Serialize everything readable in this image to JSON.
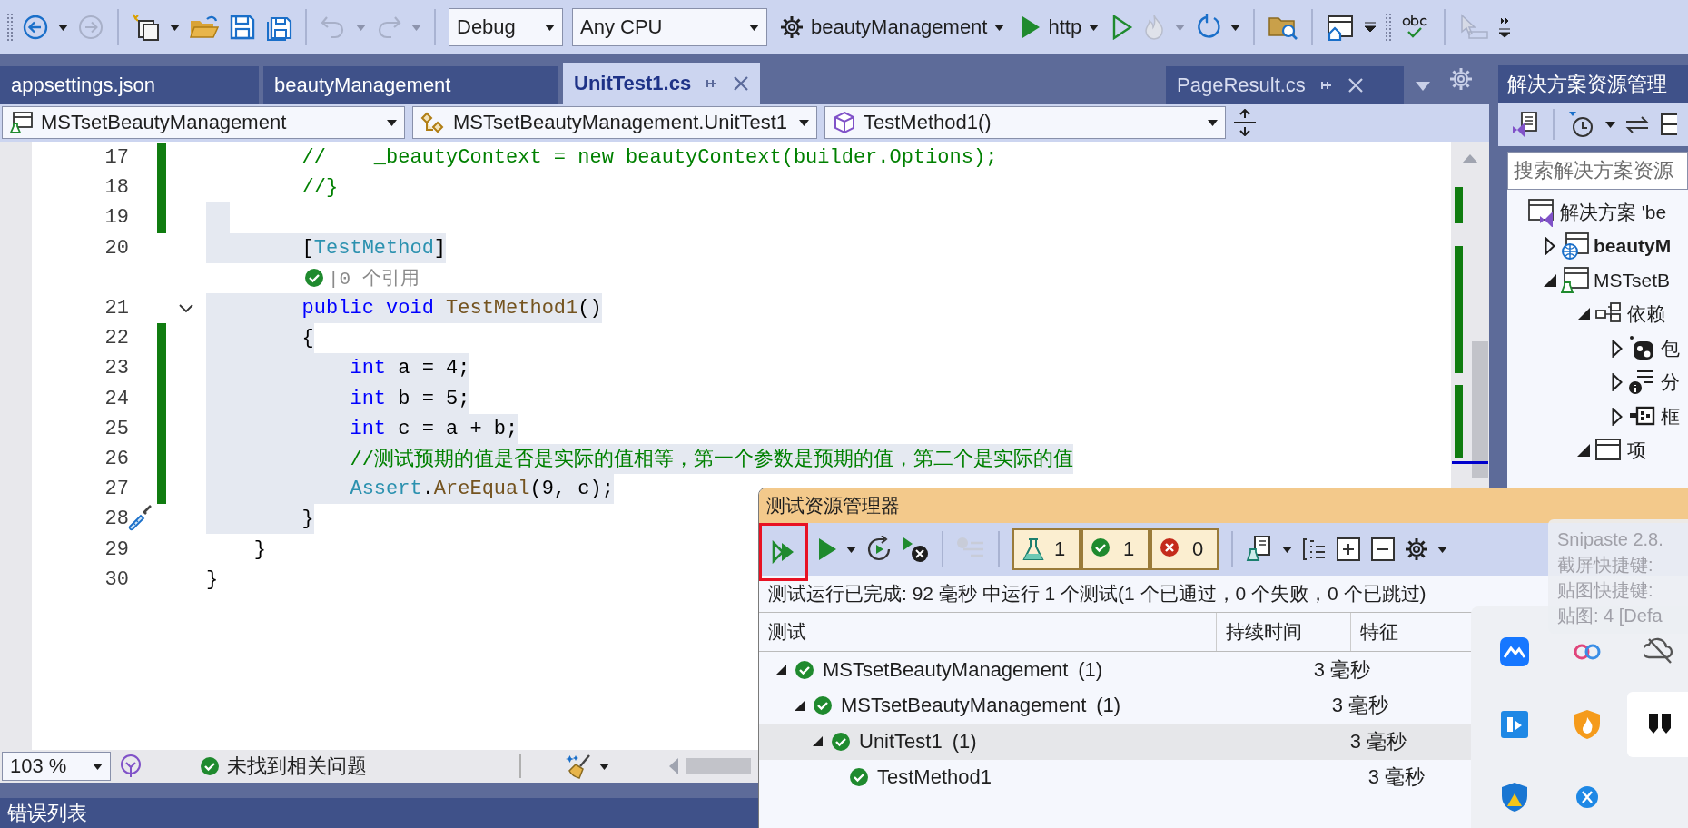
{
  "toolbar": {
    "configuration": "Debug",
    "platform": "Any CPU",
    "startup_project": "beautyManagement",
    "launch_profile": "http"
  },
  "tabs": [
    {
      "label": "appsettings.json",
      "selected": false
    },
    {
      "label": "beautyManagement",
      "selected": false
    },
    {
      "label": "UnitTest1.cs",
      "selected": true
    }
  ],
  "overflow_tabs": [
    {
      "label": "PageResult.cs",
      "selected": false
    }
  ],
  "navigation_bar": {
    "project": "MSTsetBeautyManagement",
    "type": "MSTsetBeautyManagement.UnitTest1",
    "member": "TestMethod1()"
  },
  "editor": {
    "lines": [
      {
        "kind": "code",
        "number": "17",
        "changed": true,
        "highlighted": false,
        "tokens": [
          {
            "kind": "comment",
            "text": "        //    _beautyContext = new beautyContext(builder.Options);"
          }
        ]
      },
      {
        "kind": "code",
        "number": "18",
        "changed": true,
        "highlighted": false,
        "tokens": [
          {
            "kind": "comment",
            "text": "        //}"
          }
        ]
      },
      {
        "kind": "code",
        "number": "19",
        "changed": true,
        "highlighted": true
      },
      {
        "kind": "code",
        "number": "20",
        "changed": false,
        "highlighted": true,
        "tokens": [
          {
            "kind": "plain",
            "text": "        ["
          },
          {
            "kind": "type",
            "text": "TestMethod"
          },
          {
            "kind": "plain",
            "text": "]"
          }
        ]
      },
      {
        "kind": "codelens",
        "passed": true,
        "text": "|0 个引用"
      },
      {
        "kind": "code",
        "number": "21",
        "changed": false,
        "highlighted": true,
        "expanded": true,
        "tokens": [
          {
            "kind": "keyword",
            "text": "        public void"
          },
          {
            "kind": "method",
            "text": " TestMethod1"
          },
          {
            "kind": "plain",
            "text": "()"
          }
        ]
      },
      {
        "kind": "code",
        "number": "22",
        "changed": true,
        "highlighted": true,
        "tokens": [
          {
            "kind": "plain",
            "text": "        {"
          }
        ]
      },
      {
        "kind": "code",
        "number": "23",
        "changed": true,
        "highlighted": true,
        "tokens": [
          {
            "kind": "keyword",
            "text": "            int"
          },
          {
            "kind": "plain",
            "text": " a = 4;"
          }
        ]
      },
      {
        "kind": "code",
        "number": "24",
        "changed": true,
        "highlighted": true,
        "tokens": [
          {
            "kind": "keyword",
            "text": "            int"
          },
          {
            "kind": "plain",
            "text": " b = 5;"
          }
        ]
      },
      {
        "kind": "code",
        "number": "25",
        "changed": true,
        "highlighted": true,
        "tokens": [
          {
            "kind": "keyword",
            "text": "            int"
          },
          {
            "kind": "plain",
            "text": " c = a + b;"
          }
        ]
      },
      {
        "kind": "code",
        "number": "26",
        "changed": true,
        "highlighted": true,
        "tokens": [
          {
            "kind": "comment",
            "text": "            //测试预期的值是否是实际的值相等，第一个参数是预期的值，第二个是实际的值"
          }
        ]
      },
      {
        "kind": "code",
        "number": "27",
        "changed": true,
        "highlighted": true,
        "tokens": [
          {
            "kind": "type",
            "text": "            Assert"
          },
          {
            "kind": "plain",
            "text": "."
          },
          {
            "kind": "method",
            "text": "AreEqual"
          },
          {
            "kind": "plain",
            "text": "(9, c);"
          }
        ]
      },
      {
        "kind": "code",
        "number": "28",
        "changed": false,
        "highlighted": true,
        "quick_action": true,
        "tokens": [
          {
            "kind": "plain",
            "text": "        }"
          }
        ]
      },
      {
        "kind": "code",
        "number": "29",
        "changed": false,
        "highlighted": false,
        "tokens": [
          {
            "kind": "plain",
            "text": "    }"
          }
        ]
      },
      {
        "kind": "code",
        "number": "30",
        "changed": false,
        "highlighted": false,
        "tokens": [
          {
            "kind": "plain",
            "text": "}"
          }
        ]
      }
    ],
    "status": {
      "zoom": "103 %",
      "issues": "未找到相关问题"
    }
  },
  "solution_explorer": {
    "title": "解决方案资源管理",
    "search": {
      "placeholder": "搜索解决方案资源"
    },
    "tree": [
      {
        "label": "解决方案 'be",
        "kind": "solution",
        "children": [
          {
            "label": "beautyM",
            "kind": "web",
            "expanded": false,
            "startup": true
          },
          {
            "label": "MSTsetB",
            "kind": "test",
            "expanded": true,
            "startup": false,
            "children": [
              {
                "label": "依赖",
                "kind": "deps",
                "expanded": true,
                "children": [
                  {
                    "label": "包",
                    "kind": "package",
                    "expanded": false
                  },
                  {
                    "label": "分",
                    "kind": "analyzer",
                    "expanded": false
                  },
                  {
                    "label": "框",
                    "kind": "framework",
                    "expanded": false
                  }
                ]
              },
              {
                "label": "项",
                "kind": "folder",
                "expanded": true
              }
            ]
          }
        ]
      }
    ]
  },
  "test_explorer": {
    "title": "测试资源管理器",
    "run_all_marked": true,
    "counters": [
      {
        "kind": "total",
        "count": "1"
      },
      {
        "kind": "passed",
        "count": "1"
      },
      {
        "kind": "failed",
        "count": "0"
      }
    ],
    "summary": "测试运行已完成: 92 毫秒 中运行 1 个测试(1 个已通过，0 个失败，0 个已跳过)",
    "columns": [
      "测试",
      "持续时间",
      "特征"
    ],
    "tests": [
      {
        "name": "MSTsetBeautyManagement",
        "count": "(1)",
        "duration": "3 毫秒",
        "passed": true,
        "expanded": true,
        "selected": false,
        "children": [
          {
            "name": "MSTsetBeautyManagement",
            "count": "(1)",
            "duration": "3 毫秒",
            "passed": true,
            "expanded": true,
            "selected": false,
            "children": [
              {
                "name": "UnitTest1",
                "count": "(1)",
                "duration": "3 毫秒",
                "passed": true,
                "expanded": true,
                "selected": true,
                "children": [
                  {
                    "name": "TestMethod1",
                    "duration": "3 毫秒",
                    "passed": true,
                    "selected": false
                  }
                ]
              }
            ]
          }
        ]
      }
    ]
  },
  "tooltip": {
    "lines": [
      "Snipaste 2.8.",
      "截屏快捷键:",
      "贴图快捷键:",
      "贴图: 4 [Defa"
    ]
  },
  "bottom_panel": {
    "title": "错误列表"
  }
}
